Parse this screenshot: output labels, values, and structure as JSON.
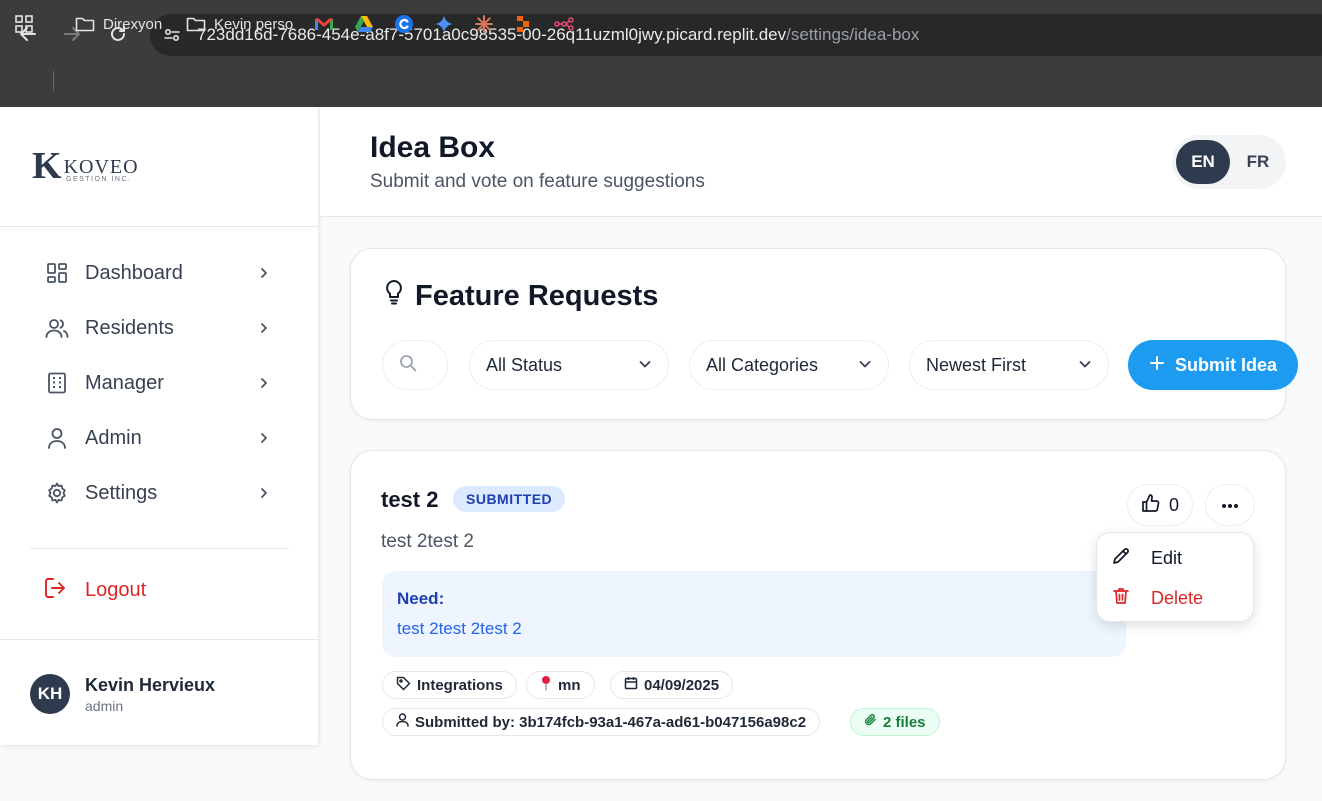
{
  "browser": {
    "url_host": "723dd16d-7686-454e-a8f7-5701a0c98535-00-26q11uzml0jwy.picard.replit.dev",
    "url_path": "/settings/idea-box",
    "bookmarks": [
      {
        "label": "Direxyon",
        "icon": "folder-icon"
      },
      {
        "label": "Kevin perso",
        "icon": "folder-icon"
      }
    ]
  },
  "sidebar": {
    "logo_text": "KOVEO",
    "logo_sub": "GESTION INC.",
    "items": [
      {
        "label": "Dashboard",
        "icon": "dashboard-icon"
      },
      {
        "label": "Residents",
        "icon": "users-icon"
      },
      {
        "label": "Manager",
        "icon": "building-icon"
      },
      {
        "label": "Admin",
        "icon": "user-icon"
      },
      {
        "label": "Settings",
        "icon": "gear-icon"
      }
    ],
    "logout_label": "Logout",
    "user": {
      "initials": "KH",
      "name": "Kevin Hervieux",
      "role": "admin"
    }
  },
  "header": {
    "title": "Idea Box",
    "subtitle": "Submit and vote on feature suggestions",
    "lang_en": "EN",
    "lang_fr": "FR"
  },
  "filters": {
    "section_title": "Feature Requests",
    "status_select": "All Status",
    "category_select": "All Categories",
    "sort_select": "Newest First",
    "submit_label": "Submit Idea"
  },
  "idea": {
    "title": "test 2",
    "status": "SUBMITTED",
    "description": "test 2test 2",
    "need_label": "Need:",
    "need_text": "test 2test 2test 2",
    "category": "Integrations",
    "location": "mn",
    "date": "04/09/2025",
    "submitted_by": "Submitted by: 3b174fcb-93a1-467a-ad61-b047156a98c2",
    "files": "2 files",
    "votes": "0"
  },
  "menu": {
    "edit_label": "Edit",
    "delete_label": "Delete"
  },
  "colors": {
    "accent": "#1d9bf0",
    "brand_dark": "#2e3b4e",
    "danger": "#dc2626"
  }
}
